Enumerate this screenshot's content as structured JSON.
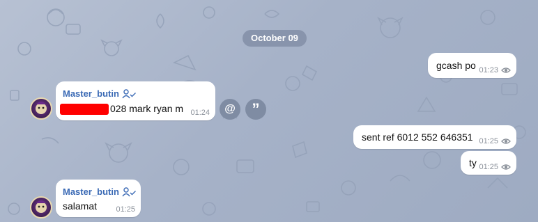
{
  "chat": {
    "date_separator": "October 09",
    "messages": [
      {
        "id": "out1",
        "direction": "outgoing",
        "text": "gcash po",
        "time": "01:23"
      },
      {
        "id": "in1",
        "direction": "incoming",
        "sender": "Master_butin",
        "text_visible": "028 mark ryan m",
        "time": "01:24",
        "redacted_prefix": true
      },
      {
        "id": "out2",
        "direction": "outgoing",
        "text": "sent ref 6012 552 646351",
        "time": "01:25"
      },
      {
        "id": "out3",
        "direction": "outgoing",
        "text": "ty",
        "time": "01:25"
      },
      {
        "id": "in2",
        "direction": "incoming",
        "sender": "Master_butin",
        "text": "salamat",
        "time": "01:25"
      }
    ]
  },
  "actions": {
    "mention_icon": "at-icon",
    "reply_icon": "quote-icon"
  },
  "colors": {
    "wallpaper": "#a6b2c8",
    "bubble": "#ffffff",
    "sender_name": "#3b6ab5",
    "date_pill": "#8894ac",
    "redaction": "#ff0000"
  }
}
